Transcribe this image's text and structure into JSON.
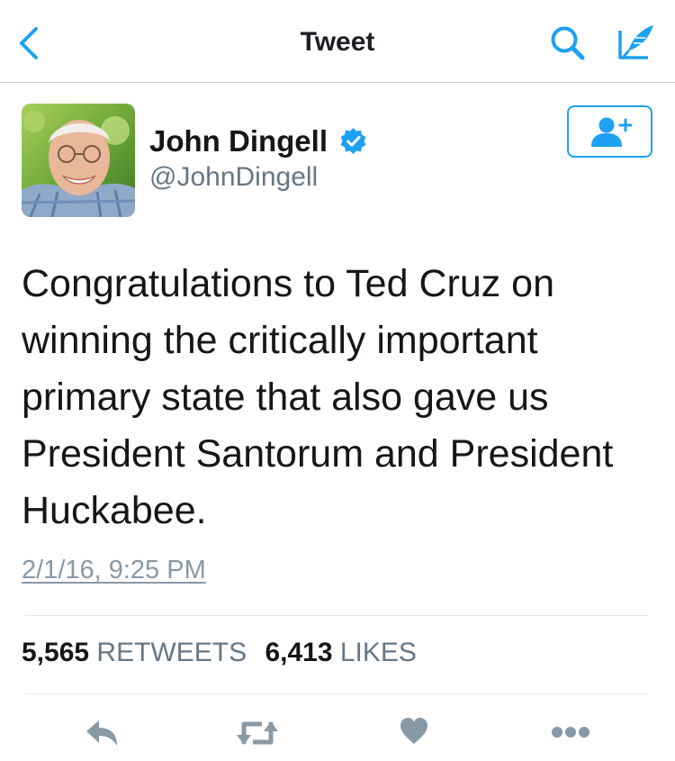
{
  "nav": {
    "title": "Tweet",
    "back_icon": "chevron-left-icon",
    "search_icon": "search-icon",
    "compose_icon": "compose-quill-icon"
  },
  "author": {
    "name": "John Dingell",
    "handle": "@JohnDingell",
    "verified": true,
    "avatar": "profile-photo"
  },
  "tweet": {
    "text": "Congratulations to Ted Cruz on winning the critically important primary state that also gave us President Santorum and President Huckabee.",
    "timestamp": "2/1/16, 9:25 PM"
  },
  "stats": {
    "retweets_count": "5,565",
    "retweets_label": "RETWEETS",
    "likes_count": "6,413",
    "likes_label": "LIKES"
  },
  "actions": [
    "reply-icon",
    "retweet-icon",
    "like-icon",
    "more-icon"
  ],
  "colors": {
    "accent": "#1da1f2",
    "text": "#14171a",
    "secondary_text": "#657786",
    "action_icons": "#8899a6",
    "divider": "#e1e8ed"
  }
}
